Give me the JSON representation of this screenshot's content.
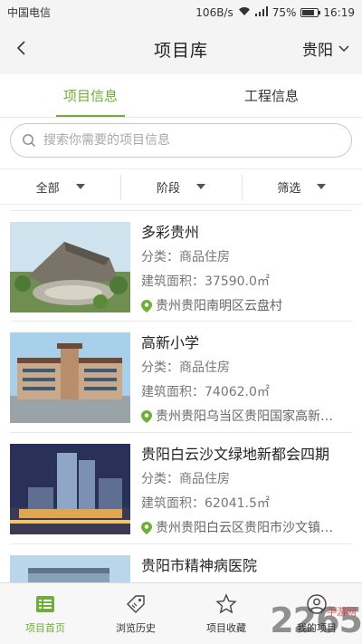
{
  "status_bar": {
    "carrier": "中国电信",
    "speed": "106B/s",
    "battery": "75%",
    "time": "16:19"
  },
  "nav": {
    "title": "项目库",
    "city": "贵阳"
  },
  "tabs": [
    {
      "label": "项目信息",
      "active": true
    },
    {
      "label": "工程信息",
      "active": false
    }
  ],
  "search": {
    "placeholder": "搜索你需要的项目信息"
  },
  "filters": [
    {
      "label": "全部"
    },
    {
      "label": "阶段"
    },
    {
      "label": "筛选"
    }
  ],
  "projects": [
    {
      "title": "多彩贵州",
      "category": "分类：商品住房",
      "area": "建筑面积：37590.0㎡",
      "address": "贵州贵阳南明区云盘村"
    },
    {
      "title": "高新小学",
      "category": "分类：商品住房",
      "area": "建筑面积：74062.0㎡",
      "address": "贵州贵阳乌当区贵阳国家高新…"
    },
    {
      "title": "贵阳白云沙文绿地新都会四期",
      "category": "分类：商品住房",
      "area": "建筑面积：62041.5㎡",
      "address": "贵州贵阳白云区贵阳市沙文镇…"
    },
    {
      "title": "贵阳市精神病医院",
      "category": "",
      "area": "",
      "address": ""
    }
  ],
  "bottom_nav": [
    {
      "label": "项目首页",
      "icon": "list-icon",
      "active": true
    },
    {
      "label": "浏览历史",
      "icon": "tag-icon",
      "active": false
    },
    {
      "label": "项目收藏",
      "icon": "star-icon",
      "active": false
    },
    {
      "label": "我的项目",
      "icon": "user-icon",
      "active": false
    }
  ],
  "watermark": {
    "big": "2265",
    "small": "手游网"
  },
  "colors": {
    "accent": "#6fae38",
    "background": "#f4f4f4"
  }
}
